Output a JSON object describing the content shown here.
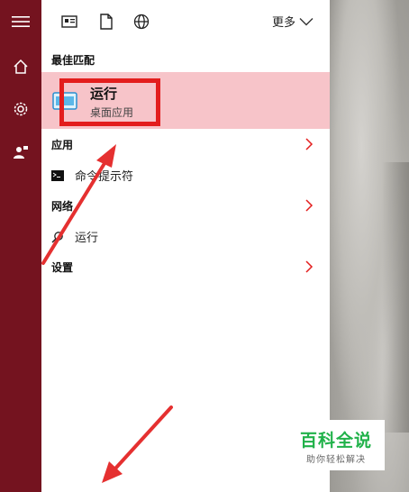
{
  "topbar": {
    "more_label": "更多"
  },
  "best_match": {
    "section_label": "最佳匹配",
    "title": "运行",
    "subtitle": "桌面应用"
  },
  "apps": {
    "section_label": "应用",
    "items": [
      {
        "label": "命令提示符",
        "icon": "cmd-icon"
      }
    ]
  },
  "web": {
    "section_label": "网络",
    "items": [
      {
        "label": "运行",
        "icon": "search-icon"
      }
    ]
  },
  "settings": {
    "section_label": "设置"
  },
  "watermark": {
    "line1": "百科全说",
    "line2": "助你轻松解决"
  },
  "colors": {
    "rail": "#74131f",
    "highlight": "#f7c4c9",
    "annotation": "#e31d1d",
    "brand": "#21b24a"
  }
}
